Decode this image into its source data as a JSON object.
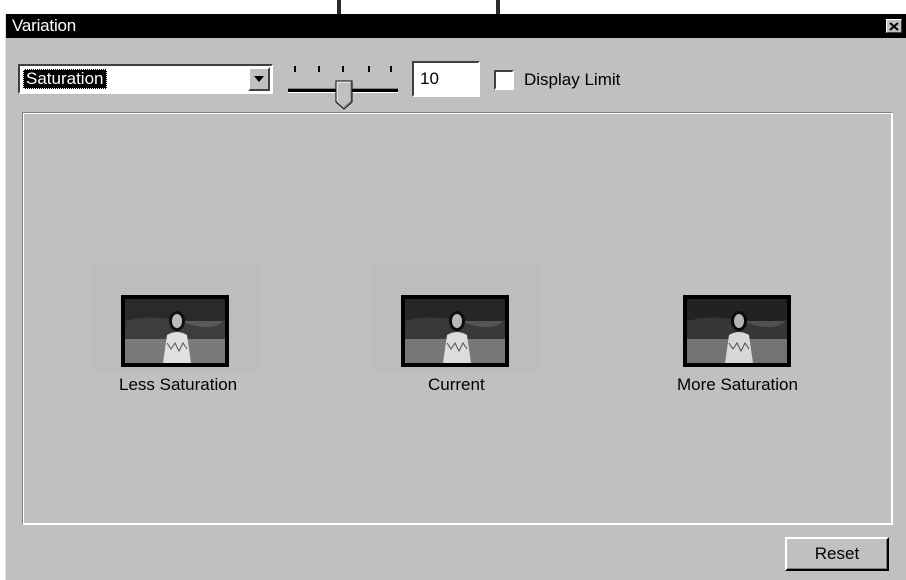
{
  "window": {
    "title": "Variation",
    "close_icon": "close-icon"
  },
  "controls": {
    "mode_select": {
      "value": "Saturation",
      "arrow_icon": "chevron-down-icon"
    },
    "amount_slider": {
      "value": 10,
      "tick_count": 5
    },
    "amount_input": {
      "value": "10"
    },
    "display_limit": {
      "label": "Display Limit",
      "checked": false
    }
  },
  "variants": [
    {
      "caption": "Less Saturation"
    },
    {
      "caption": "Current"
    },
    {
      "caption": "More Saturation"
    }
  ],
  "buttons": {
    "reset": "Reset"
  },
  "colors": {
    "title_bar": "#000000",
    "window_bg": "#c0c0c0",
    "selection": "#000000"
  }
}
